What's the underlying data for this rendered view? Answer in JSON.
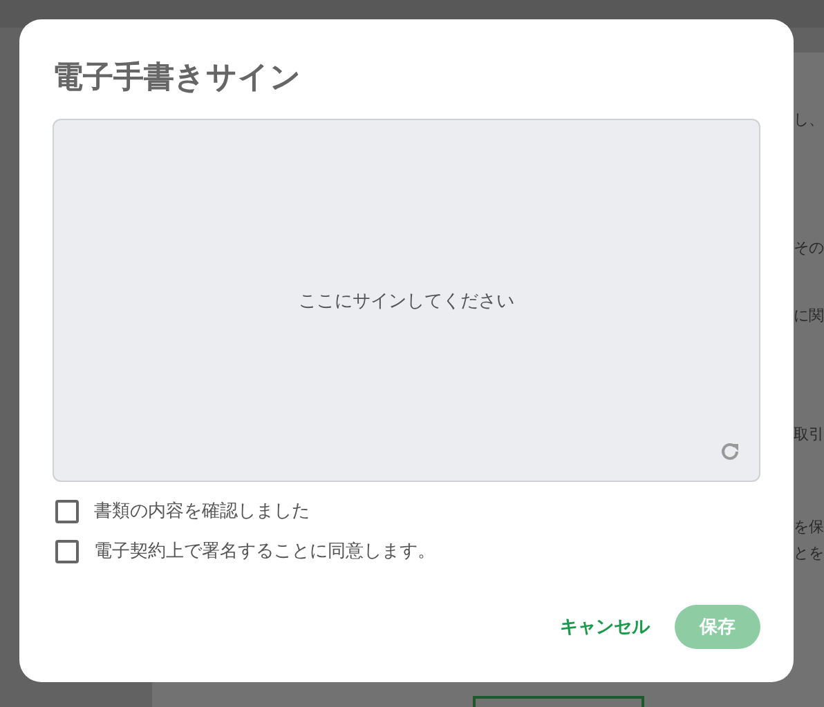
{
  "background_page": {
    "text_fragments": [
      "し、",
      "その",
      "に関",
      "取引",
      "を保",
      "とを"
    ]
  },
  "dialog": {
    "title": "電子手書きサイン",
    "signature_pad": {
      "placeholder": "ここにサインしてください"
    },
    "checkboxes": [
      {
        "label": "書類の内容を確認しました",
        "checked": false
      },
      {
        "label": "電子契約上で署名することに同意します。",
        "checked": false
      }
    ],
    "buttons": [
      {
        "kind": "text",
        "label": "キャンセル",
        "disabled": false
      },
      {
        "kind": "filled",
        "label": "保存",
        "disabled": true
      }
    ]
  }
}
